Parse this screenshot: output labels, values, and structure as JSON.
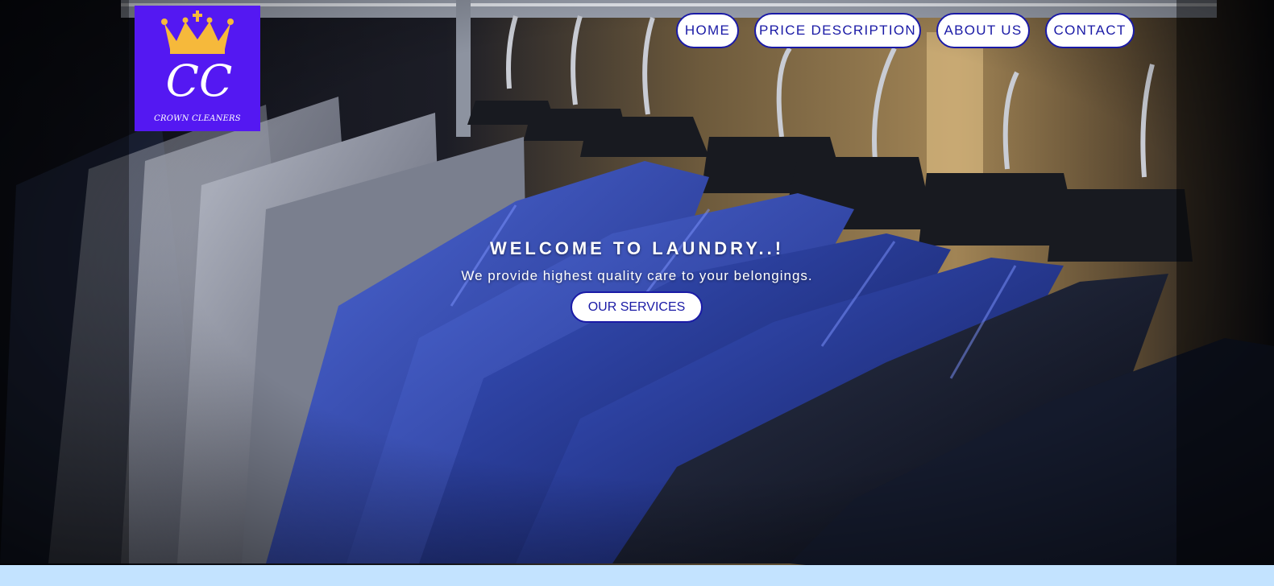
{
  "brand": {
    "monogram": "CC",
    "name": "CROWN CLEANERS",
    "logo_color": "#5418f2",
    "crown_color": "#f6b93b",
    "icon": "crown-icon"
  },
  "nav": {
    "items": [
      {
        "label": "HOME"
      },
      {
        "label": "PRICE DESCRIPTION"
      },
      {
        "label": "ABOUT US"
      },
      {
        "label": "CONTACT"
      }
    ],
    "accent_color": "#1a1aa6"
  },
  "hero": {
    "heading": "WELCOME TO LAUNDRY..!",
    "tagline": "We provide highest quality care to your belongings.",
    "cta_label": "OUR SERVICES",
    "background_subject": "suits-on-hangers"
  },
  "footer_band": {
    "color": "#c3e3ff"
  }
}
